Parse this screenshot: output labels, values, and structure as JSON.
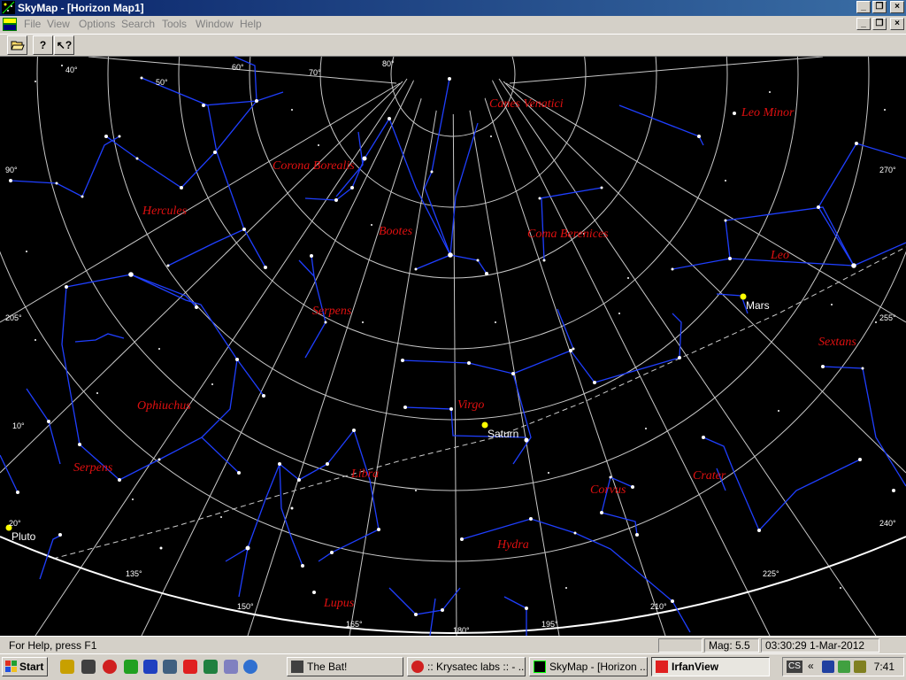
{
  "window": {
    "title": "SkyMap - [Horizon Map1]",
    "icon": "skymap-app-icon"
  },
  "menu": [
    "File",
    "View",
    "Options",
    "Search",
    "Tools",
    "Window",
    "Help"
  ],
  "toolbar": {
    "buttons": [
      "folder-open-icon",
      "help-icon",
      "context-help-icon"
    ],
    "help_glyph": "?",
    "context_glyph": "↖?"
  },
  "map": {
    "constellations": [
      "Canes Venatici",
      "Leo Minor",
      "Corona Borealis",
      "Hercules",
      "Bootes",
      "Coma Berenices",
      "Leo",
      "Serpens",
      "Sextans",
      "Ophiuchus",
      "Virgo",
      "Serpens",
      "Libra",
      "Crater",
      "Corvus",
      "Hydra",
      "Lupus"
    ],
    "planets": [
      "Mars",
      "Saturn",
      "Pluto"
    ],
    "azimuth_ticks": [
      "40°",
      "50°",
      "60°",
      "70°",
      "80°",
      "90°",
      "270°",
      "205°",
      "255°",
      "10°",
      "20°",
      "240°",
      "135°",
      "225°",
      "150°",
      "210°",
      "165°",
      "195°",
      "180°"
    ],
    "colors": {
      "background": "#000000",
      "grid": "#c8c8c8",
      "constellation_lines": "#1f3fff",
      "constellation_names": "#e01010",
      "planet": "#ffff00",
      "horizon": "#ffffff"
    }
  },
  "status": {
    "help": "For Help, press F1",
    "mag": "Mag: 5.5",
    "datetime": "03:30:29 1-Mar-2012"
  },
  "taskbar": {
    "start": "Start",
    "tasks": [
      {
        "label": "The Bat!",
        "active": false
      },
      {
        "label": ":: Krysatec labs :: - ...",
        "active": false
      },
      {
        "label": "SkyMap - [Horizon ...",
        "active": false
      },
      {
        "label": "IrfanView",
        "active": true
      }
    ],
    "tray_lang": "CS",
    "tray_chevron": "«",
    "clock": "7:41"
  }
}
